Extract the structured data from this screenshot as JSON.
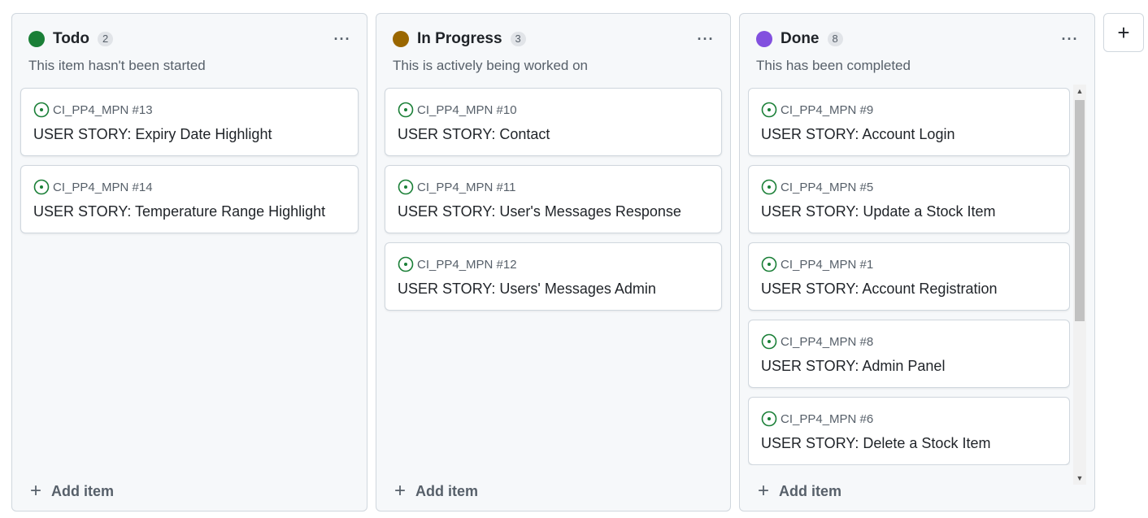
{
  "columns": [
    {
      "title": "Todo",
      "count": "2",
      "color": "#1a7f37",
      "description": "This item hasn't been started",
      "add_label": "Add item",
      "cards": [
        {
          "ref": "CI_PP4_MPN #13",
          "title": "USER STORY: Expiry Date Highlight"
        },
        {
          "ref": "CI_PP4_MPN #14",
          "title": "USER STORY: Temperature Range Highlight"
        }
      ]
    },
    {
      "title": "In Progress",
      "count": "3",
      "color": "#9a6700",
      "description": "This is actively being worked on",
      "add_label": "Add item",
      "cards": [
        {
          "ref": "CI_PP4_MPN #10",
          "title": "USER STORY: Contact"
        },
        {
          "ref": "CI_PP4_MPN #11",
          "title": "USER STORY: User's Messages Response"
        },
        {
          "ref": "CI_PP4_MPN #12",
          "title": "USER STORY: Users' Messages Admin"
        }
      ]
    },
    {
      "title": "Done",
      "count": "8",
      "color": "#8250df",
      "description": "This has been completed",
      "add_label": "Add item",
      "cards": [
        {
          "ref": "CI_PP4_MPN #9",
          "title": "USER STORY: Account Login"
        },
        {
          "ref": "CI_PP4_MPN #5",
          "title": "USER STORY: Update a Stock Item"
        },
        {
          "ref": "CI_PP4_MPN #1",
          "title": "USER STORY: Account Registration"
        },
        {
          "ref": "CI_PP4_MPN #8",
          "title": "USER STORY: Admin Panel"
        },
        {
          "ref": "CI_PP4_MPN #6",
          "title": "USER STORY: Delete a Stock Item"
        }
      ]
    }
  ],
  "issue_icon": "issue-open-icon",
  "issue_icon_color": "#1a7f37",
  "more_icon": "kebab-horizontal-icon",
  "add_column_label": "+"
}
